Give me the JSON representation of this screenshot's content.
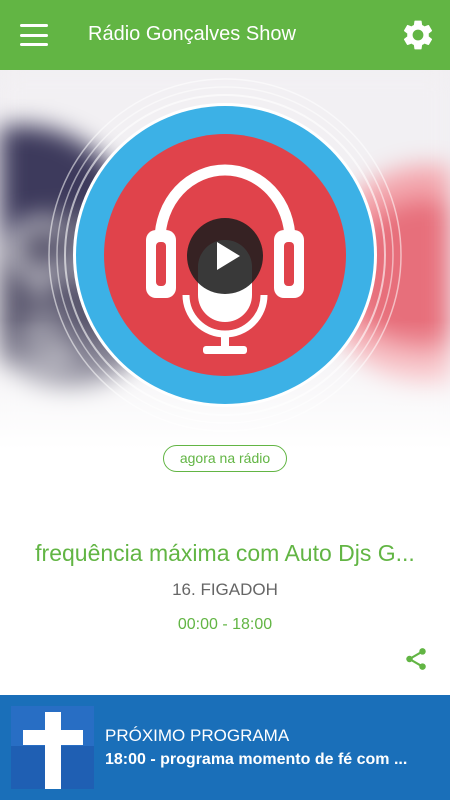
{
  "appbar": {
    "title": "Rádio Gonçalves Show",
    "menu_icon": "hamburger-menu-icon",
    "settings_icon": "gear-icon",
    "color": "#62b544"
  },
  "player": {
    "badge": "agora na rádio",
    "show_title": "frequência máxima com Auto Djs G...",
    "track": "16. FIGADOH",
    "time": "00:00 - 18:00",
    "logo_icon": "headphones-microphone-logo",
    "play_icon": "play-icon",
    "share_icon": "share-icon"
  },
  "next": {
    "label": "PRÓXIMO PROGRAMA",
    "program": "18:00 - programa momento de fé com ...",
    "thumb_icon": "cross-icon",
    "color": "#1a6fb9"
  }
}
